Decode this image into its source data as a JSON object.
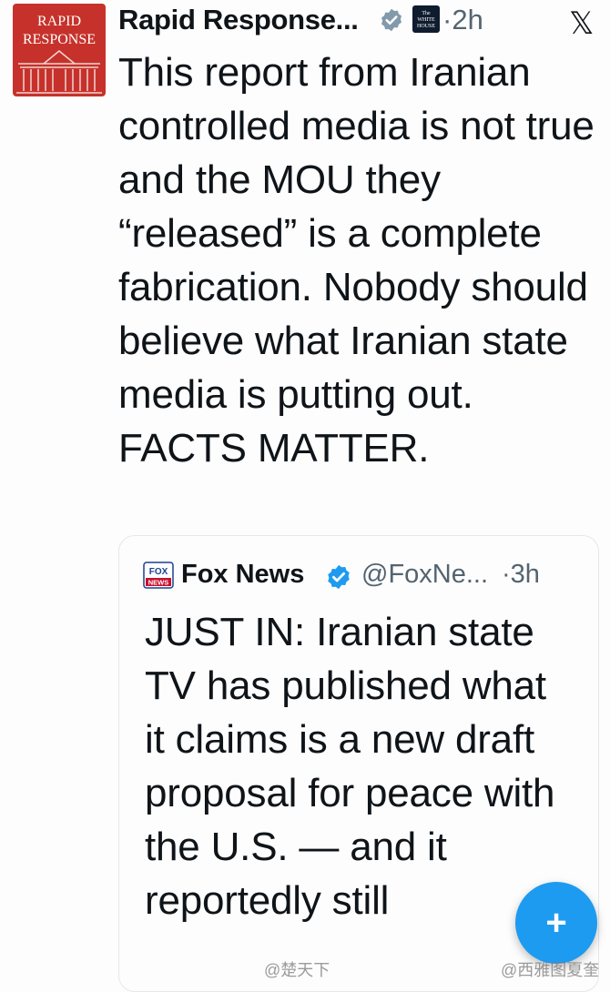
{
  "tweet": {
    "avatar_text": "RAPID\nRESPONSE",
    "author": "Rapid Response...",
    "affiliate_badge_text": "The\nWHITE\nHOUSE",
    "time": "·2h",
    "text": "This report from Iranian controlled media is not true and the MOU they “released” is a complete fabrication. Nobody should believe what Iranian state media is putting out. FACTS MATTER."
  },
  "quoted_tweet": {
    "avatar_text": "FOX NEWS",
    "author": "Fox News",
    "handle": "@FoxNe...",
    "time": "·3h",
    "text": "JUST IN: Iranian state TV has published what it claims is a new draft proposal for peace with the U.S. — and it reportedly still"
  },
  "compose_button": {
    "label": "+"
  },
  "watermarks": {
    "left": "@楚天下",
    "right": "@西雅图夏奎"
  },
  "icons": {
    "platform": "x-logo-icon",
    "verified": "verified-badge-icon",
    "compose": "compose-plus-icon"
  },
  "colors": {
    "accent": "#1d9bf0",
    "avatar_red": "#c6322b",
    "muted": "#536471"
  }
}
